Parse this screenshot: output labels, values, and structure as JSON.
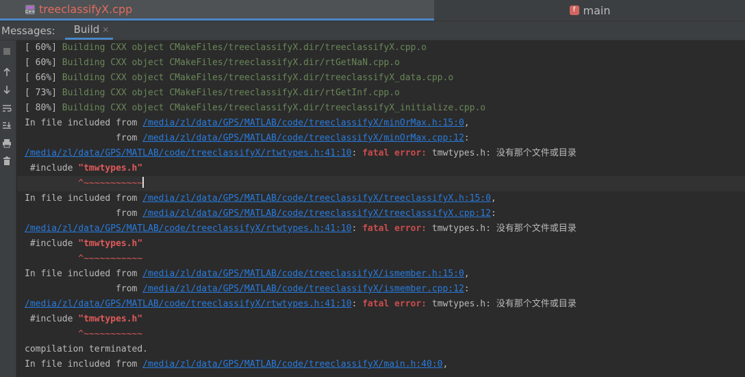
{
  "editor_tabs": {
    "active": "treeclassifyX.cpp",
    "other": "main"
  },
  "tool_window": {
    "title": "Messages:",
    "tab_label": "Build",
    "tab_close": "×"
  },
  "sidebar_icons": [
    "stop-icon",
    "arrow-up-icon",
    "arrow-down-icon",
    "soft-wrap-icon",
    "scroll-to-end-icon",
    "print-icon",
    "trash-icon"
  ],
  "console": {
    "build_lines": [
      {
        "pct": "[ 60%]",
        "msg": "Building CXX object CMakeFiles/treeclassifyX.dir/treeclassifyX.cpp.o"
      },
      {
        "pct": "[ 60%]",
        "msg": "Building CXX object CMakeFiles/treeclassifyX.dir/rtGetNaN.cpp.o"
      },
      {
        "pct": "[ 66%]",
        "msg": "Building CXX object CMakeFiles/treeclassifyX.dir/treeclassifyX_data.cpp.o"
      },
      {
        "pct": "[ 73%]",
        "msg": "Building CXX object CMakeFiles/treeclassifyX.dir/rtGetInf.cpp.o"
      },
      {
        "pct": "[ 80%]",
        "msg": "Building CXX object CMakeFiles/treeclassifyX.dir/treeclassifyX_initialize.cpp.o"
      }
    ],
    "error_blocks": [
      {
        "included_from": "In file included from ",
        "include_path": "/media/zl/data/GPS/MATLAB/code/treeclassifyX/minOrMax.h:15:0",
        "comma": ",",
        "from_prefix": "                 from ",
        "from_path": "/media/zl/data/GPS/MATLAB/code/treeclassifyX/minOrMax.cpp:12",
        "colon": ":",
        "error_path": "/media/zl/data/GPS/MATLAB/code/treeclassifyX/rtwtypes.h:41:10",
        "sep": ": ",
        "fatal": "fatal error:",
        "error_msg": " tmwtypes.h: 没有那个文件或目录",
        "include_kw": " #include ",
        "include_str": "\"tmwtypes.h\"",
        "caret_pad": "          ",
        "caret": "^~~~~~~~~~~~"
      },
      {
        "included_from": "In file included from ",
        "include_path": "/media/zl/data/GPS/MATLAB/code/treeclassifyX/treeclassifyX.h:15:0",
        "comma": ",",
        "from_prefix": "                 from ",
        "from_path": "/media/zl/data/GPS/MATLAB/code/treeclassifyX/treeclassifyX.cpp:12",
        "colon": ":",
        "error_path": "/media/zl/data/GPS/MATLAB/code/treeclassifyX/rtwtypes.h:41:10",
        "sep": ": ",
        "fatal": "fatal error:",
        "error_msg": " tmwtypes.h: 没有那个文件或目录",
        "include_kw": " #include ",
        "include_str": "\"tmwtypes.h\"",
        "caret_pad": "          ",
        "caret": "^~~~~~~~~~~~"
      },
      {
        "included_from": "In file included from ",
        "include_path": "/media/zl/data/GPS/MATLAB/code/treeclassifyX/ismember.h:15:0",
        "comma": ",",
        "from_prefix": "                 from ",
        "from_path": "/media/zl/data/GPS/MATLAB/code/treeclassifyX/ismember.cpp:12",
        "colon": ":",
        "error_path": "/media/zl/data/GPS/MATLAB/code/treeclassifyX/rtwtypes.h:41:10",
        "sep": ": ",
        "fatal": "fatal error:",
        "error_msg": " tmwtypes.h: 没有那个文件或目录",
        "include_kw": " #include ",
        "include_str": "\"tmwtypes.h\"",
        "caret_pad": "          ",
        "caret": "^~~~~~~~~~~~"
      }
    ],
    "terminated": "compilation terminated.",
    "last_line": {
      "prefix": "In file included from ",
      "path": "/media/zl/data/GPS/MATLAB/code/treeclassifyX/main.h:40:0",
      "suffix": ","
    }
  }
}
